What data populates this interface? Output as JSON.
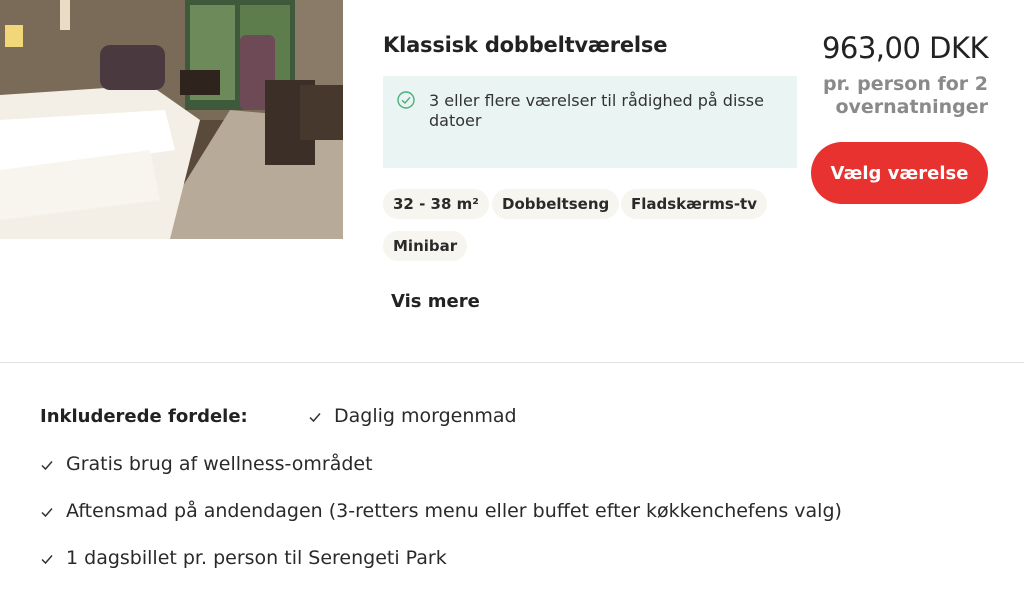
{
  "room": {
    "title": "Klassisk dobbeltværelse",
    "availability": "3 eller flere værelser til rådighed på disse datoer",
    "tags": [
      "32 - 38 m²",
      "Dobbeltseng",
      "Fladskærms-tv",
      "Minibar"
    ],
    "show_more": "Vis mere",
    "photo_icon": "hotel-room-photo"
  },
  "pricing": {
    "price": "963,00 DKK",
    "per_person": "pr. person for 2 overnatninger",
    "choose_button": "Vælg værelse"
  },
  "benefits": {
    "heading": "Inkluderede fordele:",
    "items": [
      "Daglig morgenmad",
      "Gratis brug af wellness-området",
      "Aftensmad på andendagen (3-retters menu eller buffet efter køkkenchefens valg)",
      "1 dagsbillet pr. person til Serengeti Park"
    ]
  },
  "colors": {
    "accent": "#e8322f",
    "availability_bg": "#eaf4f2",
    "check_green": "#4caf7d"
  }
}
